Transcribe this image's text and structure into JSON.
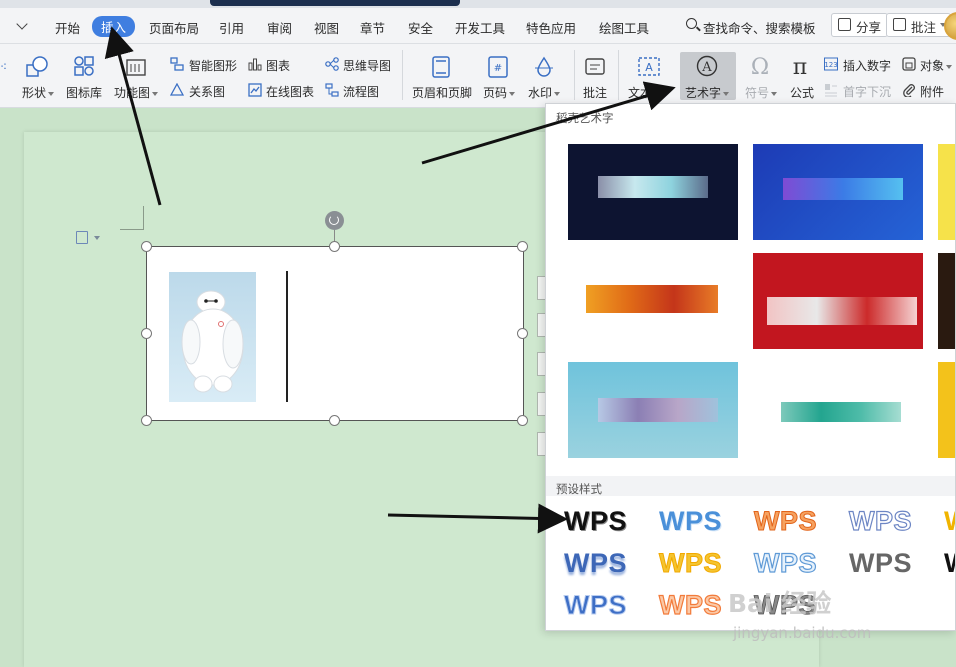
{
  "menubar": {
    "items": [
      "开始",
      "插入",
      "页面布局",
      "引用",
      "审阅",
      "视图",
      "章节",
      "安全",
      "开发工具",
      "特色应用",
      "绘图工具"
    ],
    "active": "插入",
    "search_label": "查找命令、搜索模板",
    "share_label": "分享",
    "comment_label": "批注"
  },
  "ribbon": {
    "shape_label": "形状",
    "iconlib_label": "图标库",
    "funcchart_label": "功能图",
    "smartshape_label": "智能图形",
    "chart_label": "图表",
    "mindmap_label": "思维导图",
    "relation_label": "关系图",
    "onlinechart_label": "在线图表",
    "flowchart_label": "流程图",
    "header_footer_label": "页眉和页脚",
    "pagenum_label": "页码",
    "watermark_label": "水印",
    "comment_label": "批注",
    "textbox_label": "文本",
    "wordart_label": "艺术字",
    "symbol_label": "符号",
    "formula_label": "公式",
    "insert_number_label": "插入数字",
    "object_label": "对象",
    "dropcap_label": "首字下沉",
    "attachment_label": "附件"
  },
  "panel": {
    "title": "稻壳艺术字",
    "preset_title": "预设样式",
    "presets": [
      {
        "text": "WPS",
        "color": "#111111",
        "stroke": "#ffffff"
      },
      {
        "text": "WPS",
        "color": "#4a90d9",
        "stroke": "#cfe3f7"
      },
      {
        "text": "WPS",
        "color": "#f07a2a",
        "stroke": "#f9c79b"
      },
      {
        "text": "WPS",
        "color": "#ffffff",
        "stroke": "#6d86c4"
      },
      {
        "text": "W",
        "color": "#f0b400",
        "stroke": "#fbe08a"
      },
      {
        "text": "WPS",
        "color": "#3d67b7",
        "stroke": "#9ab2de"
      },
      {
        "text": "WPS",
        "color": "#f4c430",
        "stroke": "#fff0a8"
      },
      {
        "text": "WPS",
        "color": "#ffffff",
        "stroke": "#5f9ad6"
      },
      {
        "text": "WPS",
        "color": "#666666",
        "stroke": "#cfcfcf"
      },
      {
        "text": "W",
        "color": "#111111",
        "stroke": "#ffffff"
      },
      {
        "text": "WPS",
        "color": "#3e6fc6",
        "stroke": "#b9cdf0"
      },
      {
        "text": "WPS",
        "color": "#f27b3b",
        "stroke": "#fbc9a6"
      },
      {
        "text": "WPS",
        "color": "#777777",
        "stroke": "#dddddd"
      }
    ]
  },
  "watermark": {
    "brand": "Bai 经验",
    "url": "jingyan.baidu.com"
  }
}
